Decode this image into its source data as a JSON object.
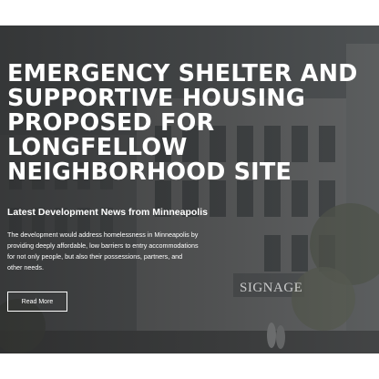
{
  "hero": {
    "headline": "EMERGENCY SHELTER AND SUPPORTIVE HOUSING PROPOSED FOR LONGFELLOW NEIGHBORHOOD SITE",
    "subtitle": "Latest Development News from Minneapolis",
    "body": "The development would address homelessness in Minneapolis by providing deeply affordable, low barriers to entry accommodations for not only people, but also their possessions, partners, and other needs.",
    "cta_label": "Read More",
    "building_sign": "SIGNAGE"
  }
}
